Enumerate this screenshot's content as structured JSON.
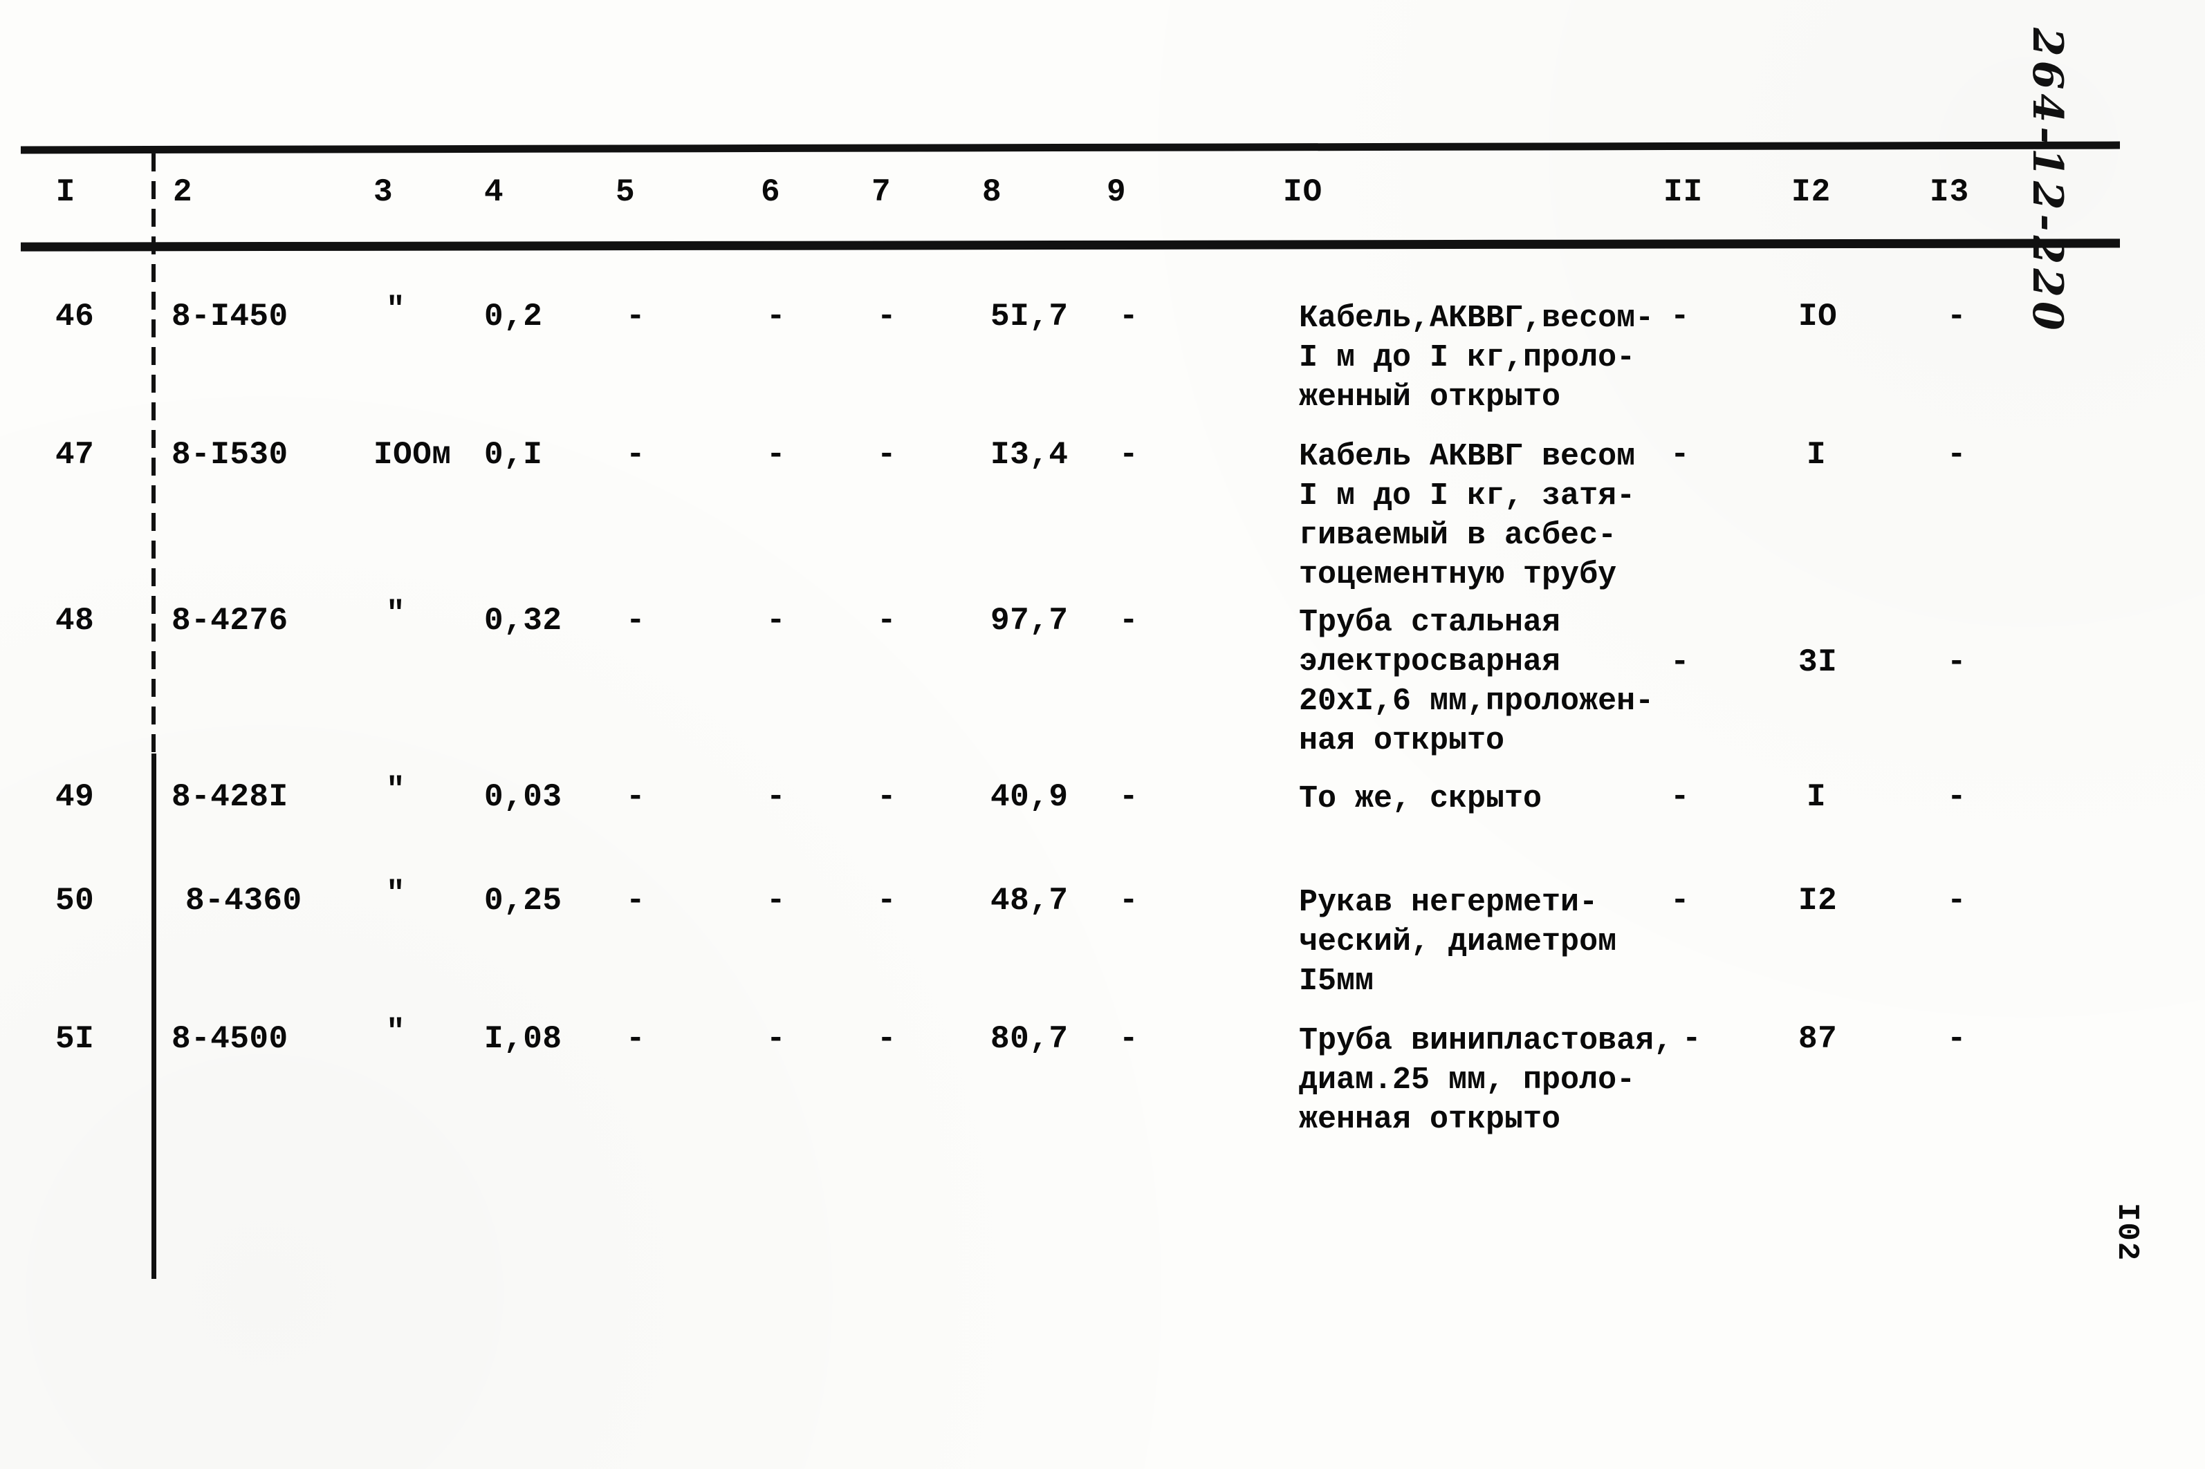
{
  "document": {
    "margin_note": "264-12-220",
    "page_number": "I02"
  },
  "table": {
    "headers": [
      "I",
      "2",
      "3",
      "4",
      "5",
      "6",
      "7",
      "8",
      "9",
      "IO",
      "II",
      "I2",
      "I3"
    ],
    "rows": [
      {
        "c1": "46",
        "c2": "8-I450",
        "c3": "\"",
        "c4": "0,2",
        "c5": "-",
        "c6": "-",
        "c7": "-",
        "c8": "5I,7",
        "c9": "-",
        "c10": "Кабель,АКВВГ,весом-\nI м до I кг,проло-\nженный открыто",
        "c11": "-",
        "c12": "IO",
        "c13": "-"
      },
      {
        "c1": "47",
        "c2": "8-I530",
        "c3": "IOOм",
        "c4": "0,I",
        "c5": "-",
        "c6": "-",
        "c7": "-",
        "c8": "I3,4",
        "c9": "-",
        "c10": "Кабель АКВВГ весом\nI м до I кг, затя-\nгиваемый в асбес-\nтоцементную трубу",
        "c11": "-",
        "c12": "I",
        "c13": "-"
      },
      {
        "c1": "48",
        "c2": "8-4276",
        "c3": "\"",
        "c4": "0,32",
        "c5": "-",
        "c6": "-",
        "c7": "-",
        "c8": "97,7",
        "c9": "-",
        "c10": "Труба стальная\nэлектросварная\n20хI,6 мм,проложен-\nная открыто",
        "c11": "-",
        "c12": "3I",
        "c13": "-"
      },
      {
        "c1": "49",
        "c2": "8-428I",
        "c3": "\"",
        "c4": "0,03",
        "c5": "-",
        "c6": "-",
        "c7": "-",
        "c8": "40,9",
        "c9": "-",
        "c10": "То же, скрыто",
        "c11": "-",
        "c12": "I",
        "c13": "-"
      },
      {
        "c1": "50",
        "c2": "8-4360",
        "c3": "\"",
        "c4": "0,25",
        "c5": "-",
        "c6": "-",
        "c7": "-",
        "c8": "48,7",
        "c9": "-",
        "c10": "Рукав негермети-\nческий, диаметром\nI5мм",
        "c11": "-",
        "c12": "I2",
        "c13": "-"
      },
      {
        "c1": "5I",
        "c2": "8-4500",
        "c3": "\"",
        "c4": "I,08",
        "c5": "-",
        "c6": "-",
        "c7": "-",
        "c8": "80,7",
        "c9": "-",
        "c10": "Труба винипластовая,\nдиам.25 мм, проло-\nженная открыто",
        "c11": "-",
        "c12": "87",
        "c13": "-"
      }
    ]
  }
}
